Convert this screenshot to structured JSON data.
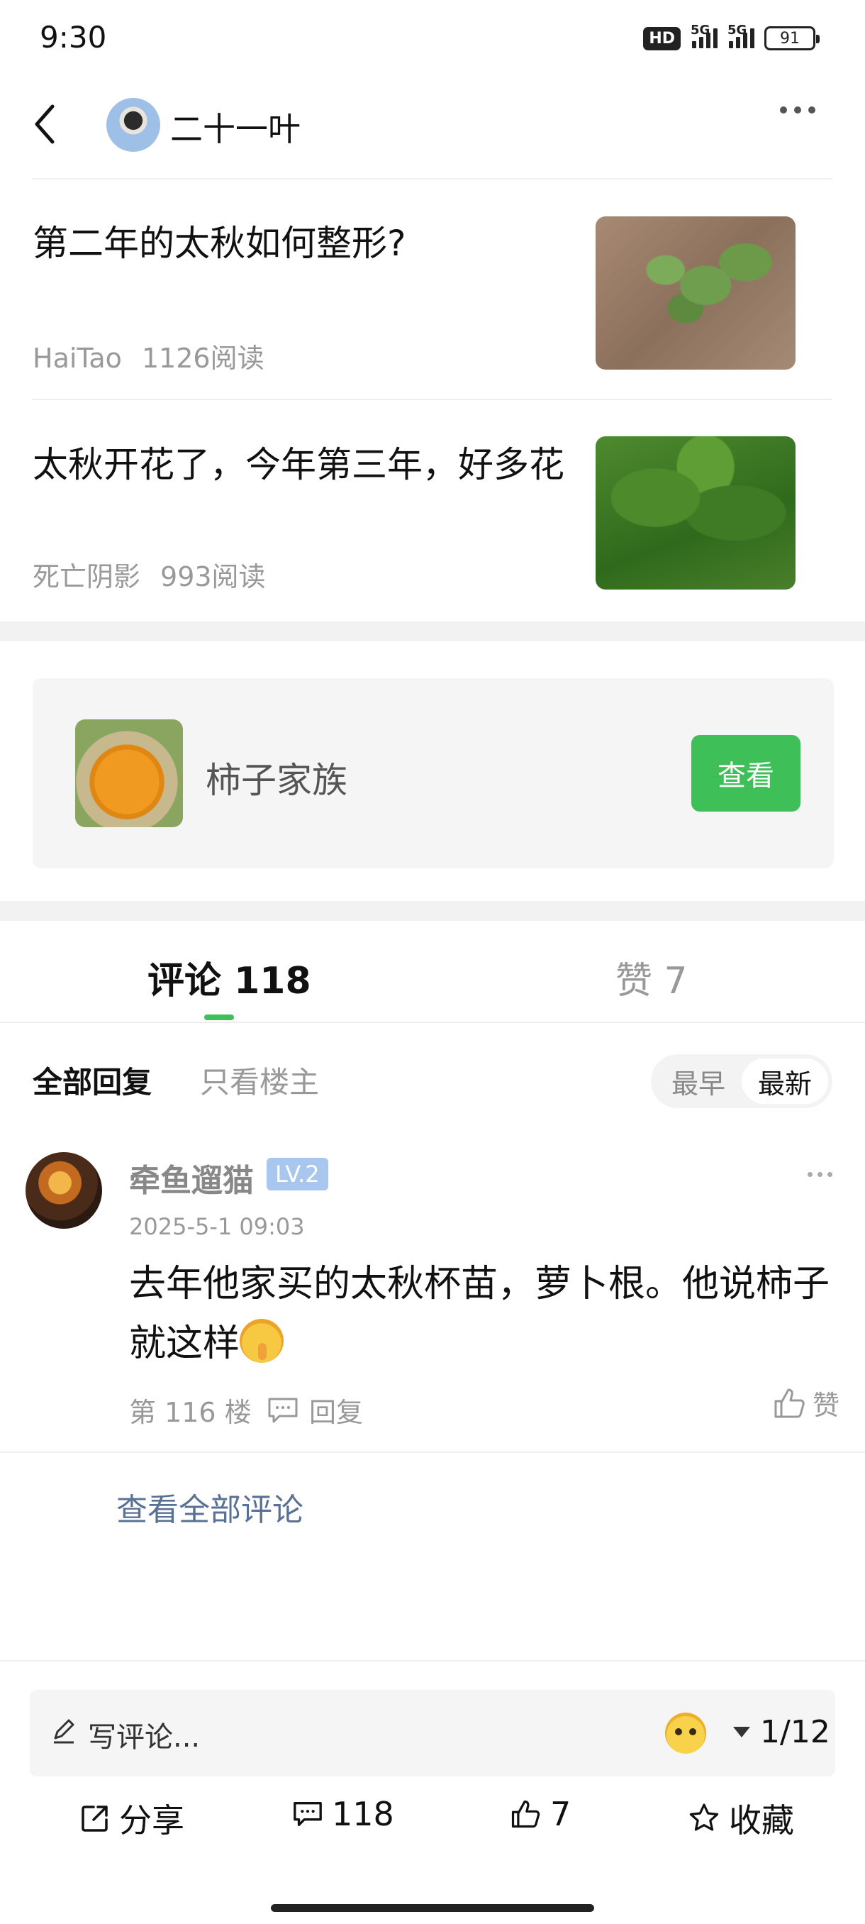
{
  "status_bar": {
    "time": "9:30",
    "hd": "HD",
    "net1": "5G",
    "net2": "5G",
    "battery": "91"
  },
  "header": {
    "author": "二十一叶",
    "back_icon": "chevron-left-icon",
    "more_icon": "more-dots-icon"
  },
  "related_articles": [
    {
      "title": "第二年的太秋如何整形?",
      "author": "HaiTao",
      "reads": "1126阅读"
    },
    {
      "title": "太秋开花了，今年第三年，好多花",
      "author": "死亡阴影",
      "reads": "993阅读"
    }
  ],
  "circle": {
    "name": "柿子家族",
    "button": "查看"
  },
  "tabs": {
    "comments": "评论 118",
    "likes": "赞 7"
  },
  "filters": {
    "all": "全部回复",
    "owner_only": "只看楼主",
    "sort": [
      "最早",
      "最新"
    ],
    "sort_active": "最新"
  },
  "comment": {
    "username": "牵鱼遛猫",
    "level": "LV.2",
    "time": "2025-5-1 09:03",
    "text": "去年他家买的太秋杯苗，萝卜根。他说柿子就这样",
    "floor": "第 116 楼",
    "reply": "回复",
    "like": "赞"
  },
  "view_all": "查看全部评论",
  "composer": {
    "placeholder": "写评论...",
    "page": "1/12"
  },
  "actions": {
    "share": "分享",
    "comments": "118",
    "likes": "7",
    "favorite": "收藏"
  },
  "colors": {
    "accent_green": "#3fbf58",
    "link_blue": "#5a7196",
    "level_badge": "#a9c7ee"
  }
}
